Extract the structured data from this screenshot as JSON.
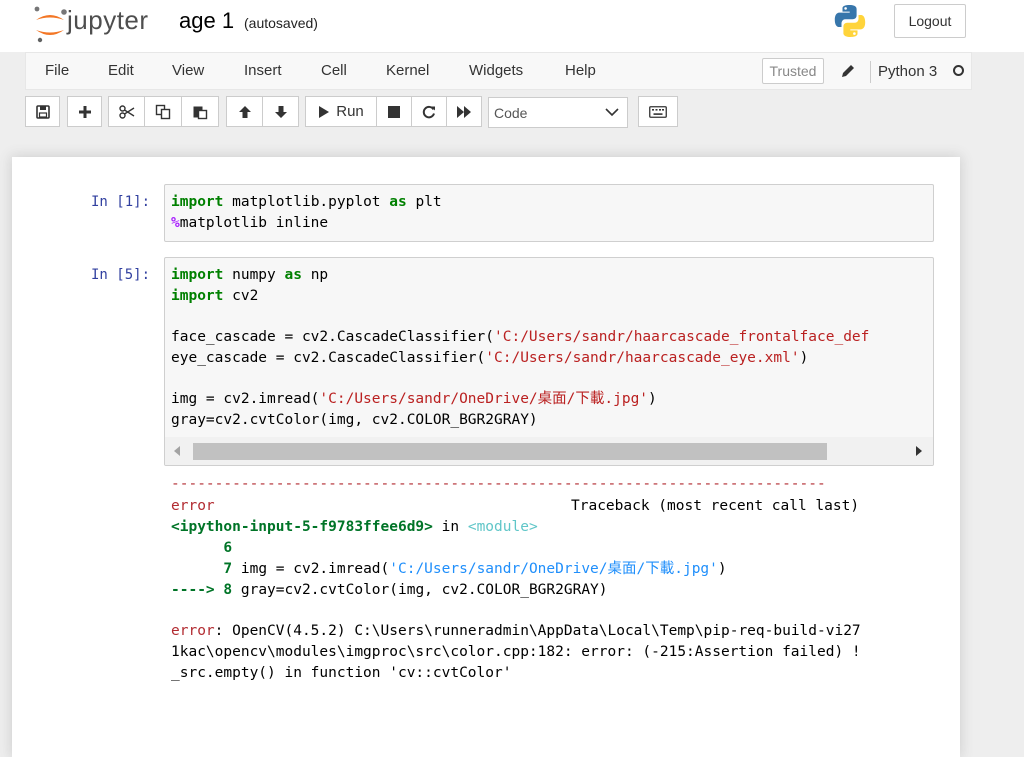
{
  "header": {
    "logo_text": "jupyter",
    "notebook_name": "age 1",
    "autosave_status": "(autosaved)",
    "logout_label": "Logout"
  },
  "menubar": {
    "items": [
      "File",
      "Edit",
      "View",
      "Insert",
      "Cell",
      "Kernel",
      "Widgets",
      "Help"
    ],
    "trusted_label": "Trusted",
    "kernel_name": "Python 3"
  },
  "toolbar": {
    "run_label": "Run",
    "cell_type": "Code",
    "cell_type_options": [
      "Code"
    ]
  },
  "cells": [
    {
      "prompt": "In [1]:",
      "code": [
        "import matplotlib.pyplot as plt",
        "%matplotlib inline"
      ]
    },
    {
      "prompt": "In [5]:",
      "code": [
        "import numpy as np",
        "import cv2",
        "",
        "face_cascade = cv2.CascadeClassifier('C:/Users/sandr/haarcascade_frontalface_def",
        "eye_cascade = cv2.CascadeClassifier('C:/Users/sandr/haarcascade_eye.xml')",
        "",
        "img = cv2.imread('C:/Users/sandr/OneDrive/桌面/下載.jpg')",
        "gray=cv2.cvtColor(img, cv2.COLOR_BGR2GRAY)"
      ],
      "output": {
        "separator": "---------------------------------------------------------------------------",
        "error_name": "error",
        "traceback_header": "Traceback (most recent call last)",
        "input_ref": "<ipython-input-5-f9783ffee6d9>",
        "in_word": "in",
        "module_ref": "<module>",
        "line6_num": "6",
        "line7_num": "7",
        "line7_code_pre": "img = cv2.imread(",
        "line7_string": "'C:/Users/sandr/OneDrive/桌面/下載.jpg'",
        "line7_code_post": ")",
        "arrow": "---->",
        "line8_num": "8",
        "line8_code": "gray=cv2.cvtColor(img, cv2.COLOR_BGR2GRAY)",
        "error_label": "error",
        "error_lines": [
          ": OpenCV(4.5.2) C:\\Users\\runneradmin\\AppData\\Local\\Temp\\pip-req-build-vi27",
          "1kac\\opencv\\modules\\imgproc\\src\\color.cpp:182: error: (-215:Assertion failed) !",
          "_src.empty() in function 'cv::cvtColor'"
        ]
      }
    }
  ],
  "icons": [
    "jupyter-logo",
    "python-logo",
    "pencil-icon",
    "kernel-idle-icon",
    "save-icon",
    "plus-icon",
    "cut-icon",
    "copy-icon",
    "paste-icon",
    "arrow-up-icon",
    "arrow-down-icon",
    "run-icon",
    "stop-icon",
    "restart-icon",
    "fast-forward-icon",
    "keyboard-icon",
    "chevron-down-icon"
  ],
  "colors": {
    "prompt": "#303f9f",
    "keyword": "#008000",
    "string": "#ba2121",
    "error_red": "#b22b31",
    "error_green": "#007427",
    "module_cyan": "#60c6c8",
    "string_blue": "#208ffb"
  }
}
